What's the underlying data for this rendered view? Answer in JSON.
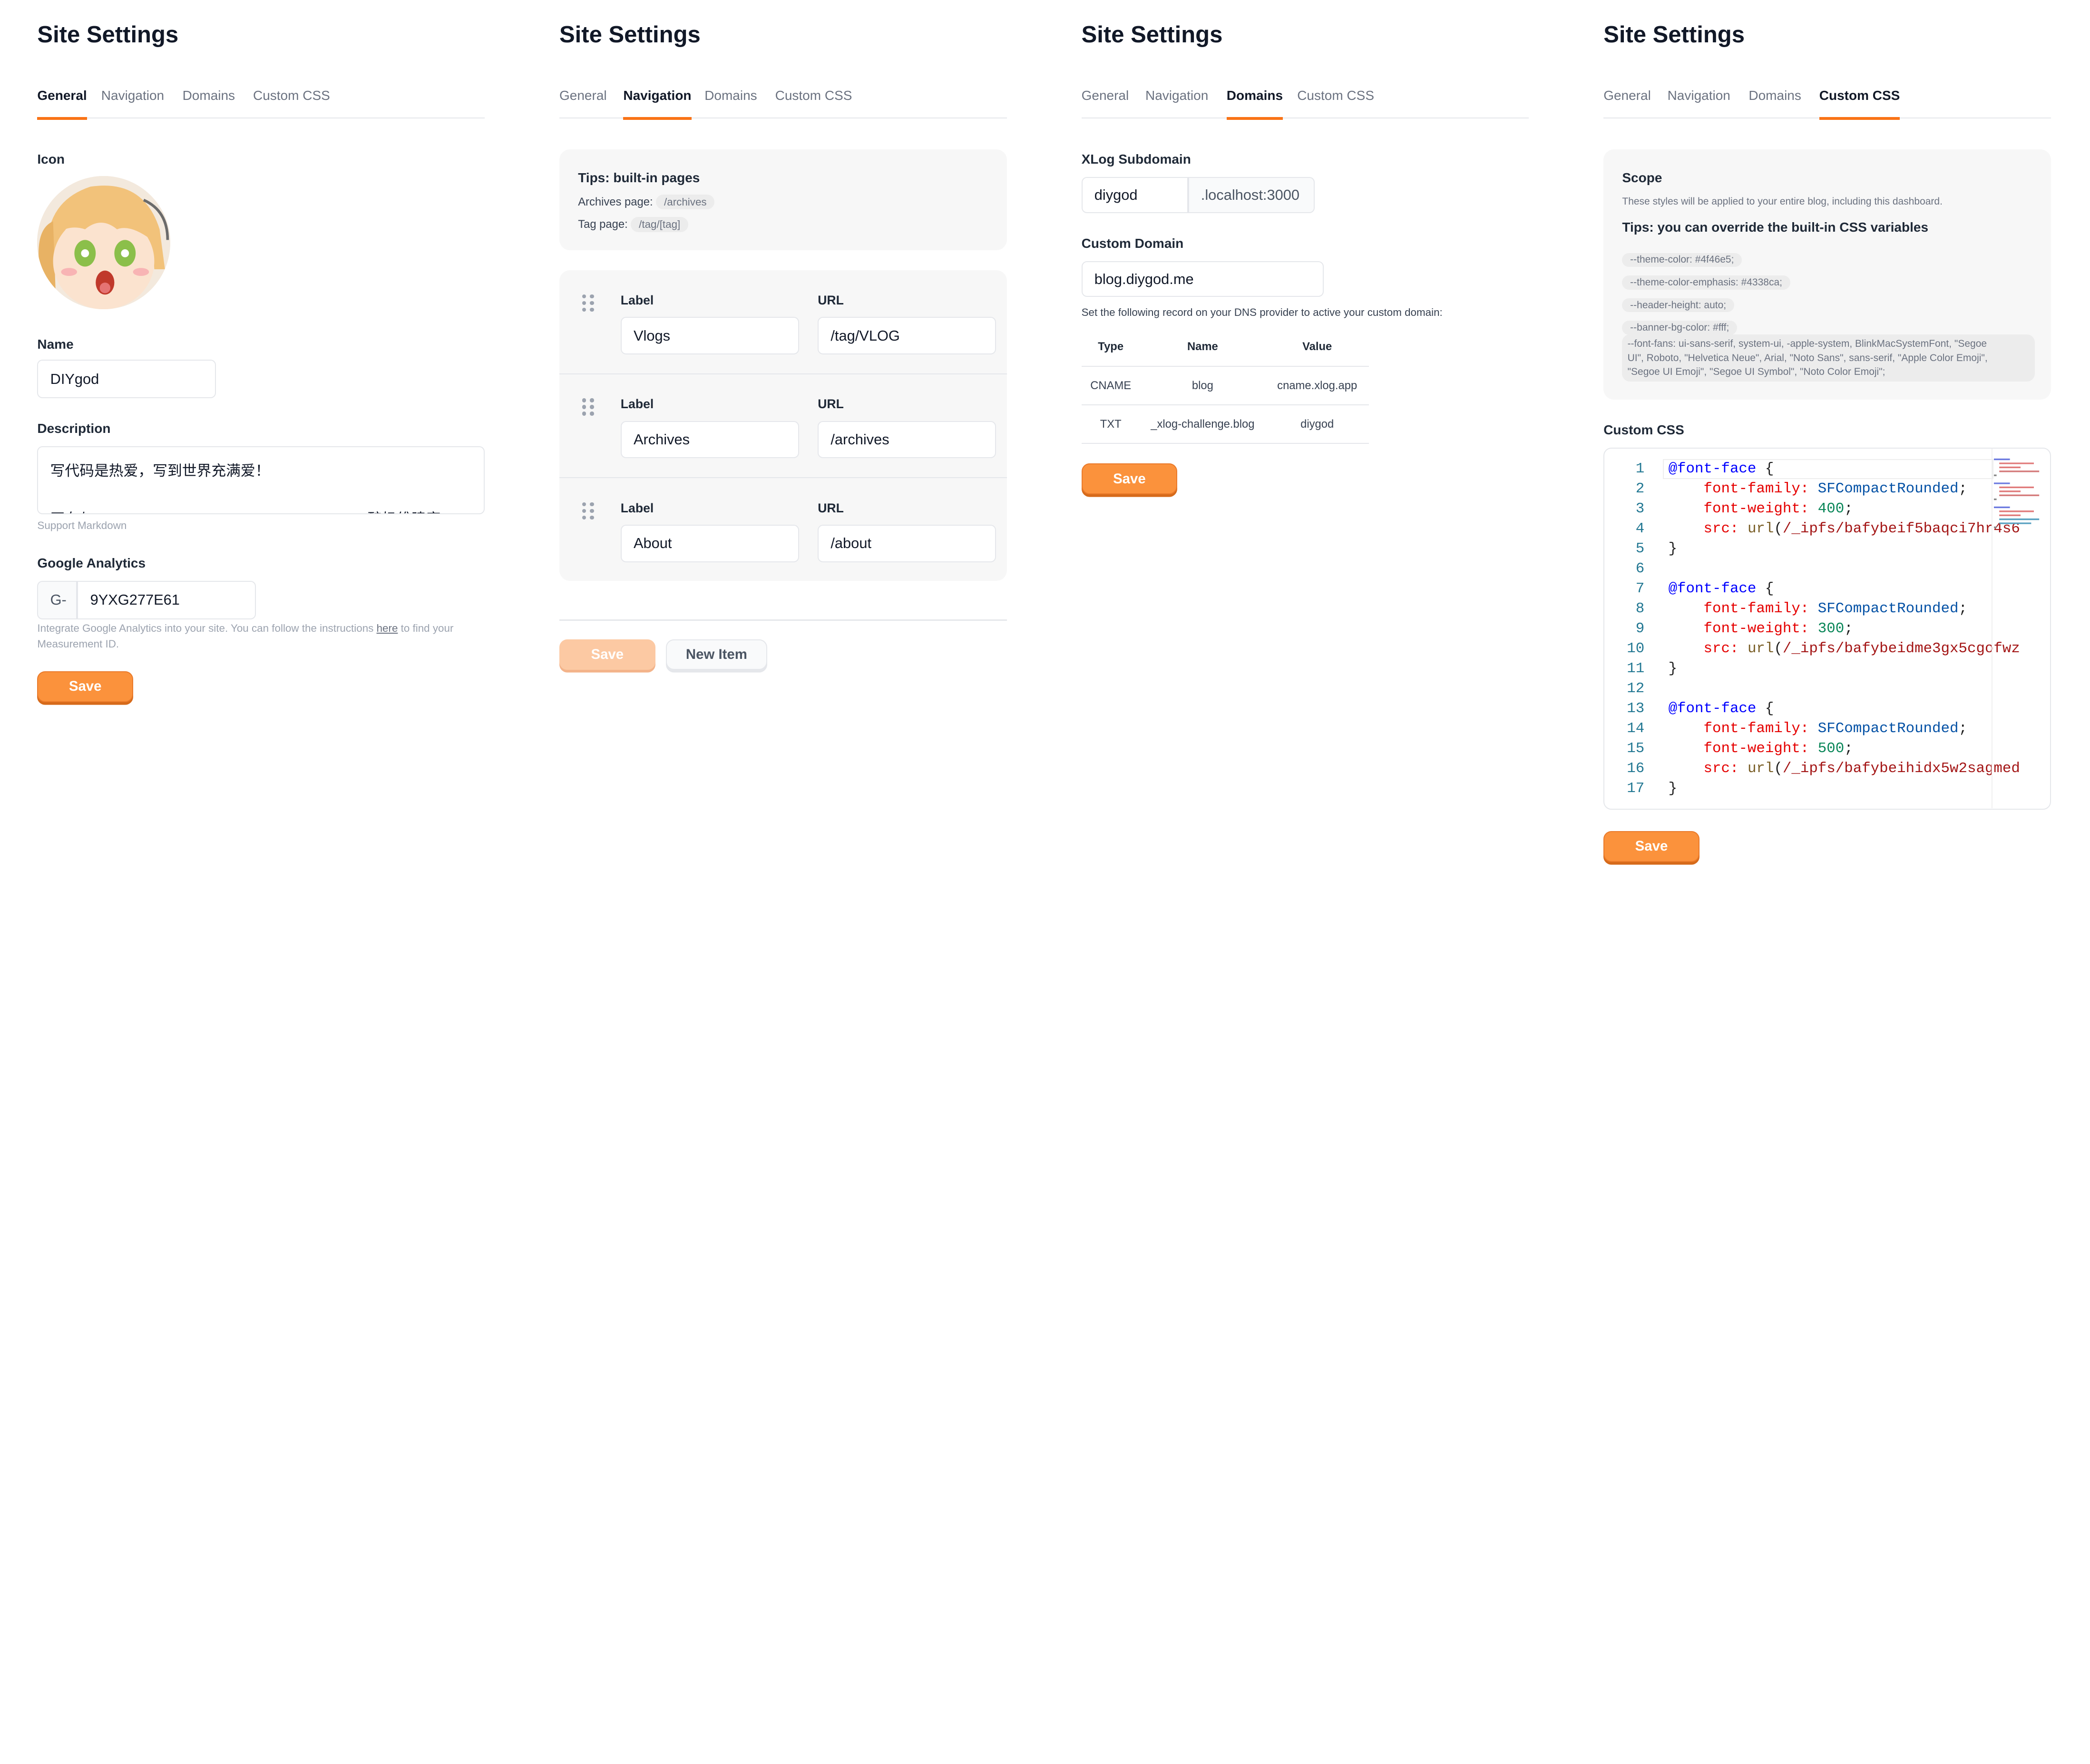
{
  "page_title": "Site Settings",
  "tabs": [
    "General",
    "Navigation",
    "Domains",
    "Custom CSS"
  ],
  "general": {
    "icon_label": "Icon",
    "name_label": "Name",
    "name_value": "DIYgod",
    "description_label": "Description",
    "description_value": "写代码是热爱，写到世界充满爱！\n\n正在与 [justcc](https://twitter.com/justjustjustcc) · 酿奶维建家",
    "support_markdown": "Support Markdown",
    "ga_label": "Google Analytics",
    "ga_prefix": "G-",
    "ga_value": "9YXG277E61",
    "ga_hint_before": "Integrate Google Analytics into your site. You can follow the instructions ",
    "ga_hint_link": "here",
    "ga_hint_after": " to find your",
    "ga_hint_line2": "Measurement ID.",
    "save_label": "Save"
  },
  "navigation": {
    "tips_title": "Tips: built-in pages",
    "archives_label": "Archives page:",
    "archives_chip": "/archives",
    "tag_label": "Tag page:",
    "tag_chip": "/tag/[tag]",
    "label_header": "Label",
    "url_header": "URL",
    "items": [
      {
        "label": "Vlogs",
        "url": "/tag/VLOG"
      },
      {
        "label": "Archives",
        "url": "/archives"
      },
      {
        "label": "About",
        "url": "/about"
      }
    ],
    "save_label": "Save",
    "new_item_label": "New Item"
  },
  "domains": {
    "subdomain_label": "XLog Subdomain",
    "subdomain_value": "diygod",
    "subdomain_suffix": ".localhost:3000",
    "custom_domain_label": "Custom Domain",
    "custom_domain_value": "blog.diygod.me",
    "instructions": "Set the following record on your DNS provider to active your custom domain:",
    "table_headers": [
      "Type",
      "Name",
      "Value"
    ],
    "records": [
      {
        "type": "CNAME",
        "name": "blog",
        "value": "cname.xlog.app"
      },
      {
        "type": "TXT",
        "name": "_xlog-challenge.blog",
        "value": "diygod"
      }
    ],
    "save_label": "Save"
  },
  "custom_css": {
    "scope_title": "Scope",
    "scope_desc": "These styles will be applied to your entire blog, including this dashboard.",
    "tips_title": "Tips: you can override the built-in CSS variables",
    "variables": [
      "--theme-color: #4f46e5;",
      "--theme-color-emphasis: #4338ca;",
      "--header-height: auto;",
      "--banner-bg-color: #fff;"
    ],
    "font_fans_lines": [
      "--font-fans: ui-sans-serif, system-ui, -apple-system, BlinkMacSystemFont, \"Segoe",
      "UI\", Roboto, \"Helvetica Neue\", Arial, \"Noto Sans\", sans-serif, \"Apple Color Emoji\",",
      "\"Segoe UI Emoji\", \"Segoe UI Symbol\", \"Noto Color Emoji\";"
    ],
    "editor_label": "Custom CSS",
    "code_lines": [
      {
        "n": "1",
        "t": "@font-face {"
      },
      {
        "n": "2",
        "t": "    font-family: SFCompactRounded;"
      },
      {
        "n": "3",
        "t": "    font-weight: 400;"
      },
      {
        "n": "4",
        "t": "    src: url(/_ipfs/bafybeif5baqci7hr4s6"
      },
      {
        "n": "5",
        "t": "}"
      },
      {
        "n": "6",
        "t": ""
      },
      {
        "n": "7",
        "t": "@font-face {"
      },
      {
        "n": "8",
        "t": "    font-family: SFCompactRounded;"
      },
      {
        "n": "9",
        "t": "    font-weight: 300;"
      },
      {
        "n": "10",
        "t": "    src: url(/_ipfs/bafybeidme3gx5cgofwz"
      },
      {
        "n": "11",
        "t": "}"
      },
      {
        "n": "12",
        "t": ""
      },
      {
        "n": "13",
        "t": "@font-face {"
      },
      {
        "n": "14",
        "t": "    font-family: SFCompactRounded;"
      },
      {
        "n": "15",
        "t": "    font-weight: 500;"
      },
      {
        "n": "16",
        "t": "    src: url(/_ipfs/bafybeihidx5w2sagmed"
      },
      {
        "n": "17",
        "t": "}"
      }
    ],
    "save_label": "Save"
  },
  "colors": {
    "accent": "#fb923c",
    "tab_underline": "#f97316",
    "panel_bg": "#f7f7f7"
  },
  "icons": [
    "drag-handle-icon",
    "avatar-image"
  ]
}
